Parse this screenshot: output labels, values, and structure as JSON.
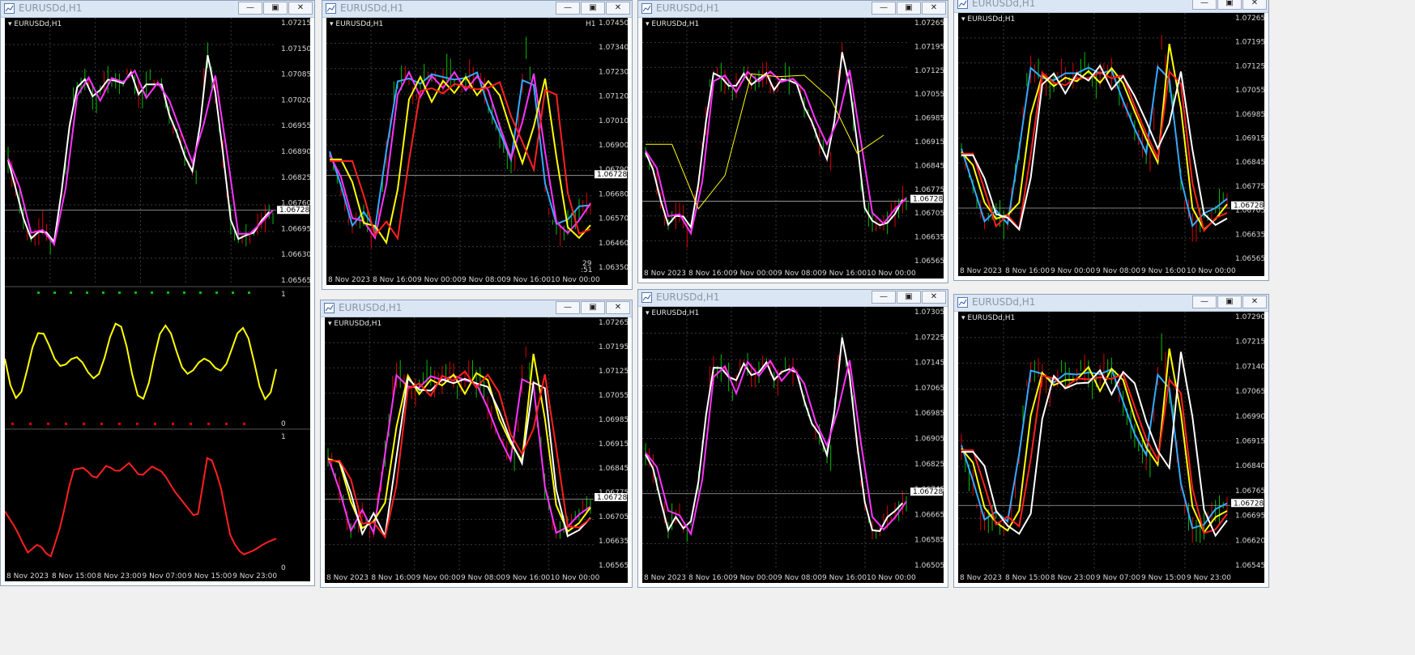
{
  "title": "EURUSDd,H1",
  "symbol": "EURUSDd,H1",
  "current_price": "1.06728",
  "timeframe_badge": "H1",
  "timer": [
    "29",
    ":51"
  ],
  "colors": {
    "bull": "#00c000",
    "bear": "#e00000",
    "white": "#ffffff",
    "magenta": "#ff33ff",
    "yellow": "#ffff00",
    "red": "#ff2020",
    "blue": "#33aaff",
    "grid": "#3a3a3a"
  },
  "windows": [
    {
      "id": "w1",
      "y_ticks": [
        "1.07215",
        "1.07150",
        "1.07085",
        "1.07020",
        "1.06955",
        "1.06890",
        "1.06825",
        "1.06760",
        "1.06695",
        "1.06630",
        "1.06565"
      ],
      "x_ticks": [
        "8 Nov 2023",
        "8 Nov 15:00",
        "8 Nov 23:00",
        "9 Nov 07:00",
        "9 Nov 15:00",
        "9 Nov 23:00"
      ],
      "sub1_ticks": [
        "1",
        "0"
      ],
      "sub2_ticks": [
        "1",
        "0"
      ]
    },
    {
      "id": "w2",
      "y_ticks": [
        "1.07450",
        "1.07340",
        "1.07230",
        "1.07120",
        "1.07010",
        "1.06900",
        "1.06790",
        "1.06680",
        "1.06570",
        "1.06460",
        "1.06350"
      ],
      "x_ticks": [
        "8 Nov 2023",
        "8 Nov 16:00",
        "9 Nov 00:00",
        "9 Nov 08:00",
        "9 Nov 16:00",
        "10 Nov 00:00"
      ]
    },
    {
      "id": "w3",
      "y_ticks": [
        "1.07265",
        "1.07195",
        "1.07125",
        "1.07055",
        "1.06985",
        "1.06915",
        "1.06845",
        "1.06775",
        "1.06705",
        "1.06635",
        "1.06565"
      ],
      "x_ticks": [
        "8 Nov 2023",
        "8 Nov 16:00",
        "9 Nov 00:00",
        "9 Nov 08:00",
        "9 Nov 16:00",
        "10 Nov 00:00"
      ]
    },
    {
      "id": "w4",
      "y_ticks": [
        "1.07265",
        "1.07195",
        "1.07125",
        "1.07055",
        "1.06985",
        "1.06915",
        "1.06845",
        "1.06775",
        "1.06705",
        "1.06635",
        "1.06565"
      ],
      "x_ticks": [
        "8 Nov 2023",
        "8 Nov 16:00",
        "9 Nov 00:00",
        "9 Nov 08:00",
        "9 Nov 16:00",
        "10 Nov 00:00"
      ]
    },
    {
      "id": "w5",
      "y_ticks": [
        "1.07265",
        "1.07195",
        "1.07125",
        "1.07055",
        "1.06985",
        "1.06915",
        "1.06845",
        "1.06775",
        "1.06705",
        "1.06635",
        "1.06565"
      ],
      "x_ticks": [
        "8 Nov 2023",
        "8 Nov 16:00",
        "9 Nov 00:00",
        "9 Nov 08:00",
        "9 Nov 16:00",
        "10 Nov 00:00"
      ]
    },
    {
      "id": "w6",
      "y_ticks": [
        "1.07305",
        "1.07225",
        "1.07145",
        "1.07065",
        "1.06985",
        "1.06905",
        "1.06825",
        "1.06745",
        "1.06665",
        "1.06585",
        "1.06505"
      ],
      "x_ticks": [
        "8 Nov 2023",
        "8 Nov 16:00",
        "9 Nov 00:00",
        "9 Nov 08:00",
        "9 Nov 16:00",
        "10 Nov 00:00"
      ]
    },
    {
      "id": "w7",
      "y_ticks": [
        "1.07290",
        "1.07215",
        "1.07140",
        "1.07065",
        "1.06990",
        "1.06915",
        "1.06840",
        "1.06765",
        "1.06695",
        "1.06620",
        "1.06545"
      ],
      "x_ticks": [
        "8 Nov 2023",
        "8 Nov 15:00",
        "8 Nov 23:00",
        "9 Nov 07:00",
        "9 Nov 15:00",
        "9 Nov 23:00"
      ]
    }
  ],
  "chart_data": {
    "type": "line",
    "symbol": "EURUSD",
    "timeframe": "H1",
    "x": [
      "8 Nov 2023",
      "8 Nov 16:00",
      "9 Nov 00:00",
      "9 Nov 08:00",
      "9 Nov 16:00",
      "10 Nov 00:00"
    ],
    "series": [
      {
        "values": [
          1.0683,
          1.0665,
          1.0659,
          1.0701,
          1.0712,
          1.0702,
          1.0709,
          1.0713,
          1.0701,
          1.0706,
          1.0694,
          1.0683,
          1.0724,
          1.0702,
          1.067,
          1.0659,
          1.0669,
          1.0673
        ]
      }
    ],
    "current_price": 1.06728
  }
}
